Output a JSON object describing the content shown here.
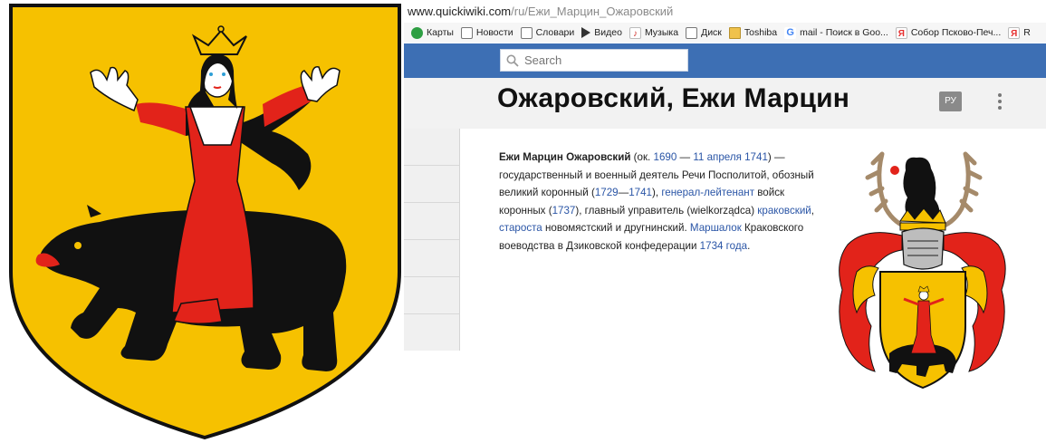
{
  "colors": {
    "shield_gold": "#f6c100",
    "maiden_red": "#e2231a",
    "bear_black": "#111111",
    "header_blue": "#3d6fb4",
    "link_blue": "#2a55a6"
  },
  "browser": {
    "url_host": "www.quickiwiki.com",
    "url_path": "/ru/Ежи_Марцин_Ожаровский",
    "bookmarks": [
      {
        "label": "Карты",
        "icon": "maps-icon"
      },
      {
        "label": "Новости",
        "icon": "page-icon"
      },
      {
        "label": "Словари",
        "icon": "page-icon"
      },
      {
        "label": "Видео",
        "icon": "play-icon"
      },
      {
        "label": "Музыка",
        "icon": "music-icon"
      },
      {
        "label": "Диск",
        "icon": "disk-icon"
      },
      {
        "label": "Toshiba",
        "icon": "folder-icon"
      },
      {
        "label": "mail - Поиск в Goo...",
        "icon": "google-icon"
      },
      {
        "label": "Собор Псково-Печ...",
        "icon": "yandex-icon"
      },
      {
        "label": "R",
        "icon": "yandex-icon"
      }
    ]
  },
  "header": {
    "search_placeholder": "Search"
  },
  "page": {
    "title": "Ожаровский, Ежи Марцин",
    "lang_button": "РУ"
  },
  "article": {
    "name": "Ежи Марцин Ожаровский",
    "t1": " (ок. ",
    "l_1690": "1690",
    "t2": " — ",
    "l_date": "11 апреля 1741",
    "t3": ") — государственный и военный деятель Речи Посполитой, обозный великий коронный (",
    "l_1729": "1729",
    "t4": "—",
    "l_1741": "1741",
    "t5": "), ",
    "l_general": "генерал-лейтенант",
    "t6": " войск коронных (",
    "l_1737": "1737",
    "t7": "), главный управитель (wielkorządca) ",
    "l_krak": "краковский",
    "t8": ", ",
    "l_starosta": "староста",
    "t9": " новомястский и другнинский. ",
    "l_marshal": "Маршалок",
    "t10": " Краковского воеводства в Дзиковской конфедерации ",
    "l_1734": "1734 года",
    "t11": "."
  }
}
